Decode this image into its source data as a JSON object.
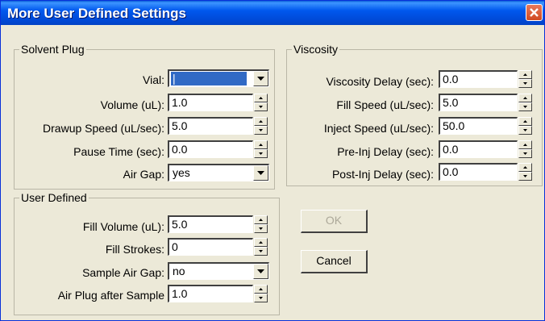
{
  "window": {
    "title": "More User Defined Settings"
  },
  "solvent_plug": {
    "legend": "Solvent Plug",
    "vial_label": "Vial:",
    "vial_value": "|",
    "volume_label": "Volume (uL):",
    "volume_value": "1.0",
    "drawup_label": "Drawup Speed (uL/sec):",
    "drawup_value": "5.0",
    "pause_label": "Pause Time (sec):",
    "pause_value": "0.0",
    "airgap_label": "Air Gap:",
    "airgap_value": "yes"
  },
  "viscosity": {
    "legend": "Viscosity",
    "delay_label": "Viscosity Delay (sec):",
    "delay_value": "0.0",
    "fill_label": "Fill Speed (uL/sec):",
    "fill_value": "5.0",
    "inject_label": "Inject Speed (uL/sec):",
    "inject_value": "50.0",
    "preinj_label": "Pre-Inj Delay (sec):",
    "preinj_value": "0.0",
    "postinj_label": "Post-Inj Delay (sec):",
    "postinj_value": "0.0"
  },
  "user_defined": {
    "legend": "User Defined",
    "fillvol_label": "Fill Volume (uL):",
    "fillvol_value": "5.0",
    "strokes_label": "Fill Strokes:",
    "strokes_value": "0",
    "sampleair_label": "Sample Air Gap:",
    "sampleair_value": "no",
    "airplug_label": "Air Plug after Sample",
    "airplug_value": "1.0"
  },
  "buttons": {
    "ok": "OK",
    "cancel": "Cancel"
  },
  "icons": {
    "close": "close-icon",
    "spin": "spin-arrows-icon",
    "dropdown": "chevron-down-icon"
  }
}
